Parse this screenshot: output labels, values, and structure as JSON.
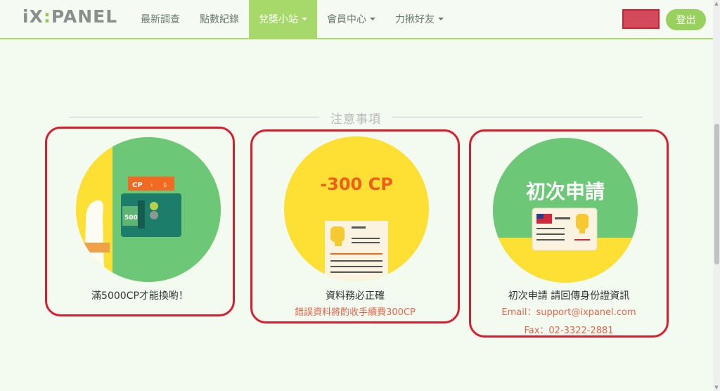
{
  "logo": "iX:PANEL",
  "nav": {
    "items": [
      {
        "label": "最新調查",
        "dropdown": false,
        "active": false
      },
      {
        "label": "點數紀錄",
        "dropdown": false,
        "active": false
      },
      {
        "label": "兌獎小站",
        "dropdown": true,
        "active": true
      },
      {
        "label": "會員中心",
        "dropdown": true,
        "active": false
      },
      {
        "label": "力揪好友",
        "dropdown": true,
        "active": false
      }
    ],
    "logout": "登出"
  },
  "section_title": "注意事項",
  "cards": [
    {
      "icon_name": "wallet-5000-icon",
      "cp_tag": "CP",
      "wallet_amount": "5000",
      "caption": "滿5000CP才能換喲！"
    },
    {
      "icon_name": "id-card-deduction-icon",
      "badge": "-300 CP",
      "caption": "資料務必正確",
      "sub": "錯誤資料將酌收手續費300CP"
    },
    {
      "icon_name": "id-card-first-apply-icon",
      "badge": "初次申請",
      "caption": "初次申請 請回傳身份證資訊",
      "email": "Email：support@ixpanel.com",
      "fax": "Fax：02-3322-2881"
    }
  ],
  "colors": {
    "accent_green": "#a6d86a",
    "circle_green": "#6cc777",
    "circle_yellow": "#fde033",
    "highlight_red": "#d91d2e",
    "sub_text": "#e0664a"
  }
}
